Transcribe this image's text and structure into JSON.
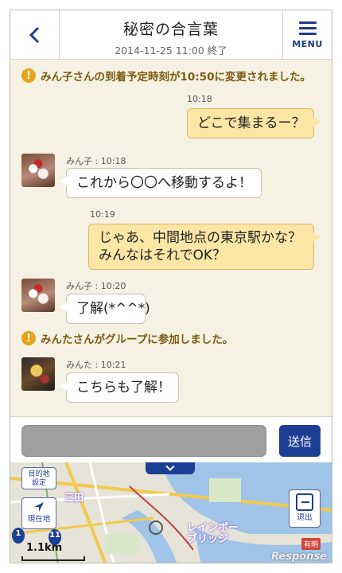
{
  "header": {
    "title": "秘密の合言葉",
    "subtitle": "2014-11-25 11:00 終了",
    "menu_label": "MENU"
  },
  "chat": {
    "notice1": "みん子さんの到着予定時刻が10:50に変更されました。",
    "msg1": {
      "time": "10:18",
      "text": "どこで集まるー？"
    },
    "msg2": {
      "meta": "みん子 : 10:18",
      "text": "これから〇〇へ移動するよ！"
    },
    "msg3": {
      "time": "10:19",
      "line1": "じゃあ、中間地点の東京駅かな？",
      "line2": "みんなはそれでOK？"
    },
    "msg4": {
      "meta": "みん子 : 10:20",
      "text": "了解(*^^*)"
    },
    "notice2": "みんたさんがグループに参加しました。",
    "msg5": {
      "meta": "みんた : 10:21",
      "text": "こちらも了解！"
    }
  },
  "input": {
    "value": "",
    "send_label": "送信"
  },
  "map": {
    "dest_label_1": "目的地",
    "dest_label_2": "設定",
    "current_label": "現在地",
    "exit_label": "退出",
    "scale": "1.1km",
    "station_label": "三田",
    "bridge_line1": "レインボー",
    "bridge_line2": "ブリッジ",
    "badge": "有明",
    "watermark": "Response",
    "pin1": "1",
    "pin2": "11"
  },
  "colors": {
    "accent": "#1c3e94",
    "notice": "#e4a51a",
    "my_bubble": "#fbe6a6",
    "chat_bg": "#f6f2e3"
  }
}
